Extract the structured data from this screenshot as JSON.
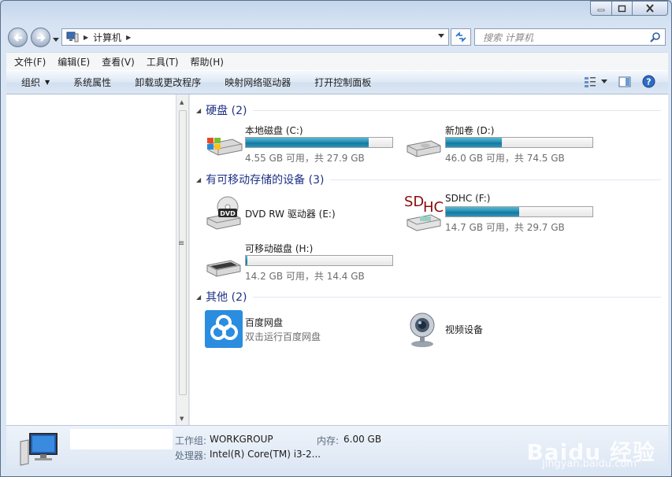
{
  "address": {
    "crumb": "计算机"
  },
  "search": {
    "placeholder": "搜索 计算机"
  },
  "menu": [
    "文件(F)",
    "编辑(E)",
    "查看(V)",
    "工具(T)",
    "帮助(H)"
  ],
  "commands": {
    "organize": "组织",
    "system_props": "系统属性",
    "uninstall": "卸载或更改程序",
    "map_drive": "映射网络驱动器",
    "control_panel": "打开控制面板"
  },
  "groups": {
    "hard_disks": "硬盘 (2)",
    "removable": "有可移动存储的设备 (3)",
    "other": "其他 (2)"
  },
  "drives": {
    "c": {
      "name": "本地磁盘 (C:)",
      "free": "4.55 GB 可用，共 27.9 GB",
      "used_fraction": 0.84
    },
    "d": {
      "name": "新加卷 (D:)",
      "free": "46.0 GB 可用，共 74.5 GB",
      "used_fraction": 0.38
    },
    "e": {
      "name": "DVD RW 驱动器 (E:)"
    },
    "f": {
      "name": "SDHC (F:)",
      "free": "14.7 GB 可用，共 29.7 GB",
      "used_fraction": 0.5
    },
    "h": {
      "name": "可移动磁盘 (H:)",
      "free": "14.2 GB 可用，共 14.4 GB",
      "used_fraction": 0.01
    }
  },
  "other": {
    "baidu": {
      "name": "百度网盘",
      "sub": "双击运行百度网盘"
    },
    "camera": {
      "name": "视频设备"
    }
  },
  "details": {
    "workgroup_label": "工作组:",
    "workgroup": "WORKGROUP",
    "memory_label": "内存:",
    "memory": "6.00 GB",
    "cpu_label": "处理器:",
    "cpu": "Intel(R) Core(TM) i3-2..."
  },
  "watermark": {
    "logo": "Baidu 经验",
    "url": "jingyan.baidu.com"
  },
  "colors": {
    "group_title": "#1e3287",
    "bar_fill": "#2790b5"
  }
}
